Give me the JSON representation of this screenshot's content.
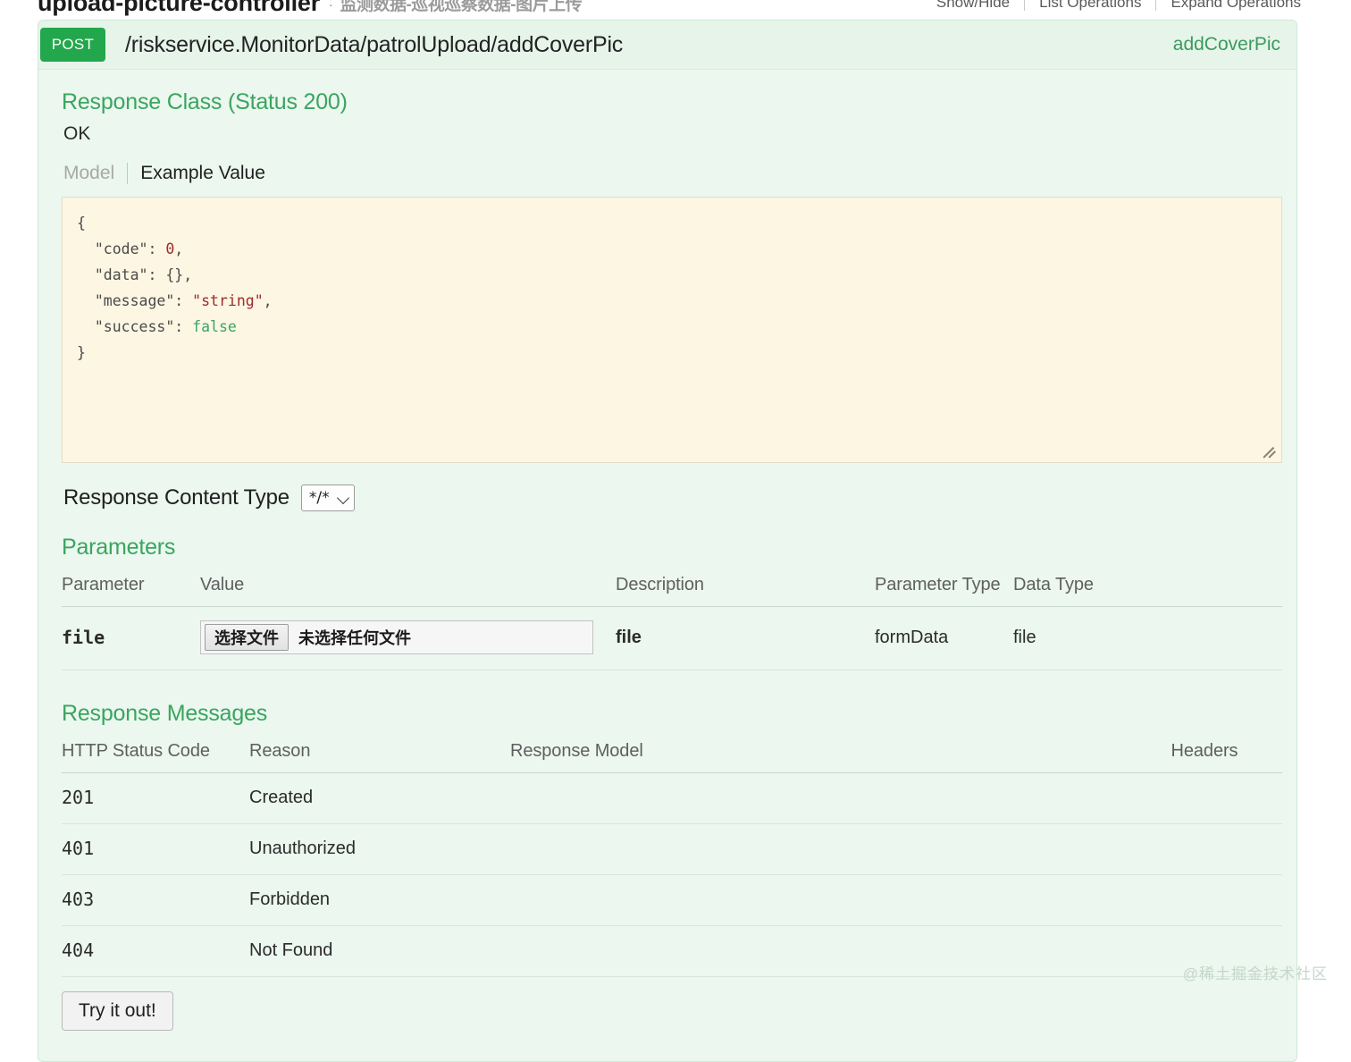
{
  "resource": {
    "title": "upload-picture-controller",
    "separator": ":",
    "description": "监测数据-巡视巡察数据-图片上传",
    "links": [
      {
        "label": "Show/Hide"
      },
      {
        "label": "List Operations"
      },
      {
        "label": "Expand Operations"
      }
    ]
  },
  "operation": {
    "method": "POST",
    "path": "/riskservice.MonitorData/patrolUpload/addCoverPic",
    "nickname": "addCoverPic",
    "response_class": {
      "heading": "Response Class (Status 200)",
      "status_text": "OK",
      "tabs": [
        {
          "label": "Model",
          "active": false
        },
        {
          "label": "Example Value",
          "active": true
        }
      ],
      "example_value": {
        "line_open": "{",
        "line_close": "}",
        "fields": [
          {
            "key": "\"code\"",
            "value": "0",
            "type": "num",
            "comma": ","
          },
          {
            "key": "\"data\"",
            "value": "{}",
            "type": "punct",
            "comma": ","
          },
          {
            "key": "\"message\"",
            "value": "\"string\"",
            "type": "str",
            "comma": ","
          },
          {
            "key": "\"success\"",
            "value": "false",
            "type": "bool",
            "comma": ""
          }
        ]
      }
    },
    "content_type": {
      "label": "Response Content Type",
      "selected": "*/*",
      "options": [
        "*/*"
      ]
    },
    "parameters": {
      "heading": "Parameters",
      "columns": [
        "Parameter",
        "Value",
        "Description",
        "Parameter Type",
        "Data Type"
      ],
      "rows": [
        {
          "name": "file",
          "value_control": {
            "type": "file",
            "button_label": "选择文件",
            "status_text": "未选择任何文件"
          },
          "description": "file",
          "parameter_type": "formData",
          "data_type": "file"
        }
      ]
    },
    "response_messages": {
      "heading": "Response Messages",
      "columns": [
        "HTTP Status Code",
        "Reason",
        "Response Model",
        "Headers"
      ],
      "rows": [
        {
          "code": "201",
          "reason": "Created",
          "model": "",
          "headers": ""
        },
        {
          "code": "401",
          "reason": "Unauthorized",
          "model": "",
          "headers": ""
        },
        {
          "code": "403",
          "reason": "Forbidden",
          "model": "",
          "headers": ""
        },
        {
          "code": "404",
          "reason": "Not Found",
          "model": "",
          "headers": ""
        }
      ]
    },
    "try_button": "Try it out!"
  },
  "watermark": "@稀土掘金技术社区",
  "colors": {
    "method_post": "#22a74c",
    "panel_bg": "#ebf7ef",
    "section_heading": "#3aa55f",
    "code_bg": "#fdf6e3",
    "nickname": "#3a9b5c"
  }
}
